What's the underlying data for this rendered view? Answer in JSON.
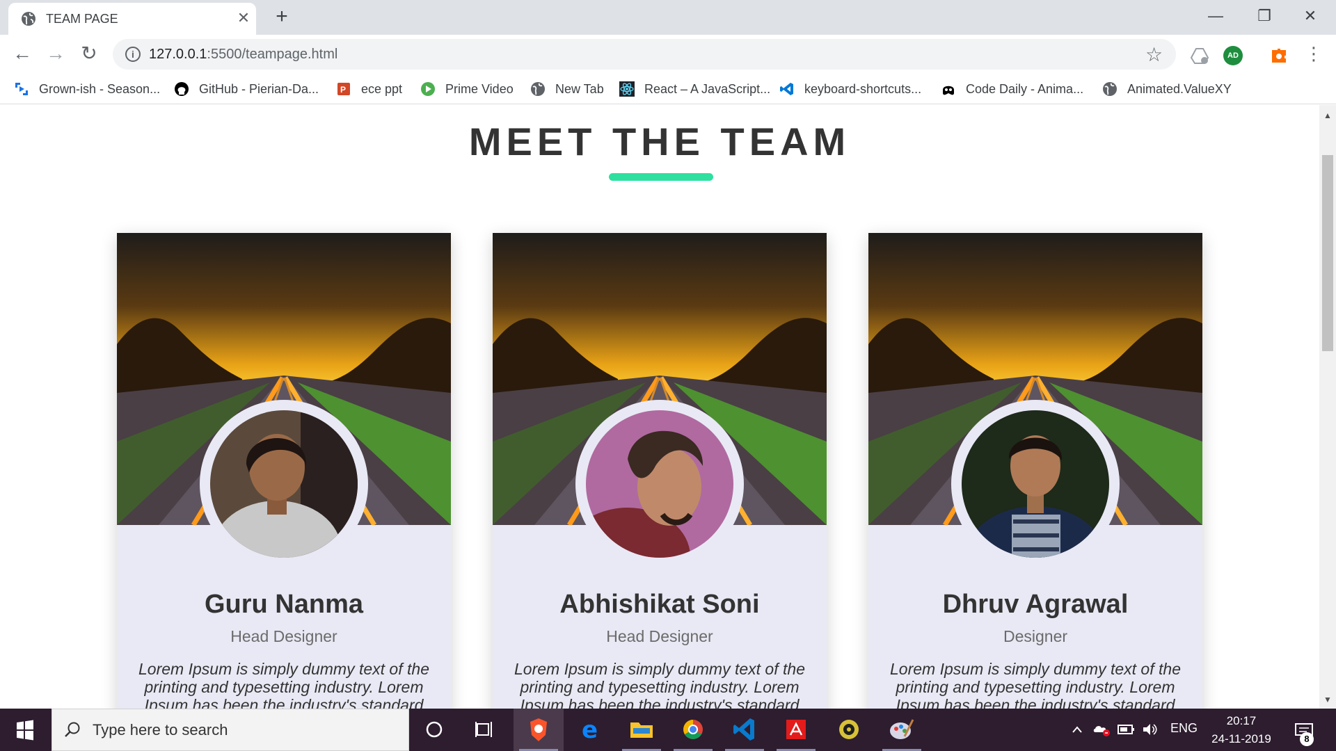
{
  "browser": {
    "tab_title": "TEAM PAGE",
    "tab_close_glyph": "✕",
    "new_tab_glyph": "+",
    "url_host": "127.0.0.1",
    "url_path": ":5500/teampage.html",
    "window_controls": {
      "minimize": "—",
      "maximize": "❐",
      "close": "✕"
    },
    "nav": {
      "back": "←",
      "forward": "→",
      "reload": "↻",
      "info": "i",
      "star": "☆",
      "menu": "⋮"
    },
    "profile_initials": "AD"
  },
  "bookmarks": [
    {
      "label": "Grown-ish - Season...",
      "icon": "stream-icon",
      "color": "#1a73e8"
    },
    {
      "label": "GitHub - Pierian-Da...",
      "icon": "github-icon",
      "color": "#000000"
    },
    {
      "label": "ece ppt",
      "icon": "powerpoint-icon",
      "color": "#d24726"
    },
    {
      "label": "Prime Video",
      "icon": "prime-video-icon",
      "color": "#4caf50"
    },
    {
      "label": "New Tab",
      "icon": "globe-icon",
      "color": "#5f6368"
    },
    {
      "label": "React – A JavaScript...",
      "icon": "react-icon",
      "color": "#61dafb"
    },
    {
      "label": "keyboard-shortcuts...",
      "icon": "vscode-icon",
      "color": "#0078d7"
    },
    {
      "label": "Code Daily - Anima...",
      "icon": "codedaily-icon",
      "color": "#000000"
    },
    {
      "label": "Animated.ValueXY",
      "icon": "globe-icon",
      "color": "#5f6368"
    }
  ],
  "page": {
    "title": "MEET THE TEAM",
    "accent_color": "#2ee0a0",
    "members": [
      {
        "name": "Guru Nanma",
        "role": "Head Designer",
        "description": "Lorem Ipsum is simply dummy text of the printing and typesetting industry. Lorem Ipsum has been the industry's standard dummy text"
      },
      {
        "name": "Abhishikat Soni",
        "role": "Head Designer",
        "description": "Lorem Ipsum is simply dummy text of the printing and typesetting industry. Lorem Ipsum has been the industry's standard dummy text"
      },
      {
        "name": "Dhruv Agrawal",
        "role": "Designer",
        "description": "Lorem Ipsum is simply dummy text of the printing and typesetting industry. Lorem Ipsum has been the industry's standard dummy text"
      }
    ]
  },
  "taskbar": {
    "search_placeholder": "Type here to search",
    "language": "ENG",
    "time": "20:17",
    "date": "24-11-2019",
    "notification_count": "8",
    "apps": [
      "brave-icon",
      "edge-icon",
      "file-explorer-icon",
      "chrome-icon",
      "vscode-icon",
      "acrobat-icon",
      "media-icon",
      "paint-icon"
    ]
  }
}
